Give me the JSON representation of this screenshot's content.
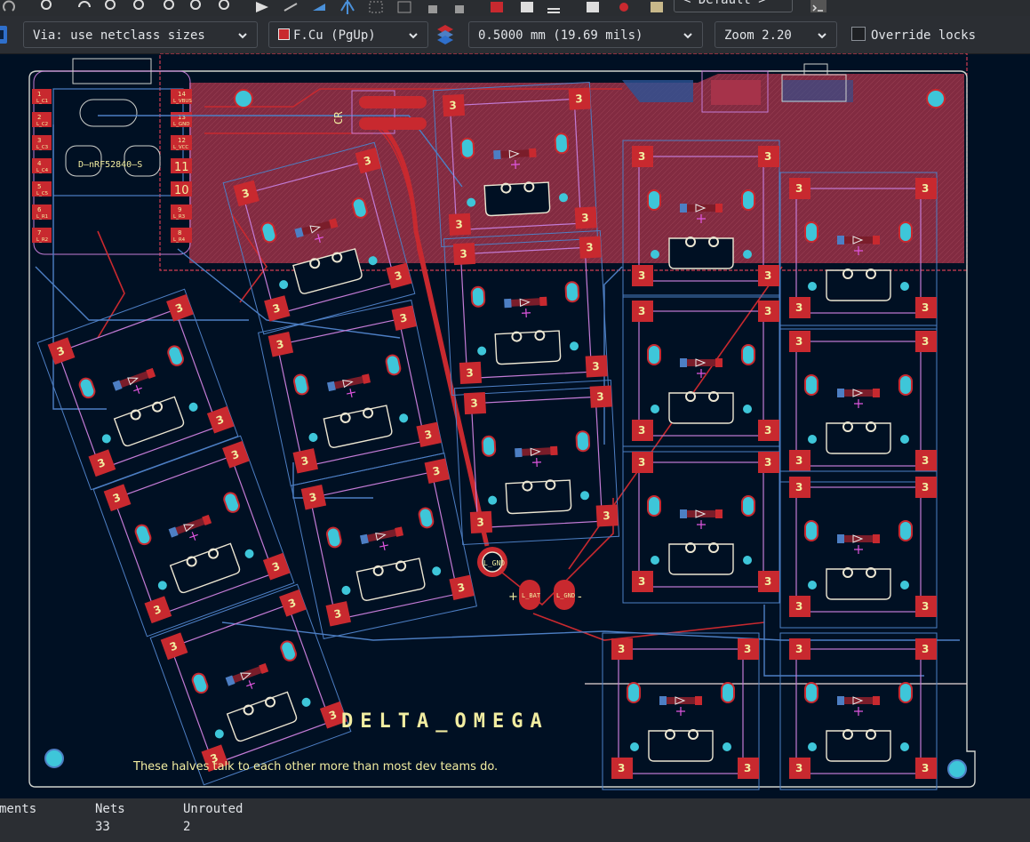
{
  "toolbar": {
    "via_size": "Via: use netclass sizes",
    "layer": "F.Cu (PgUp)",
    "track_width": "0.5000 mm (19.69 mils)",
    "zoom": "Zoom 2.20",
    "override_locks": "Override locks",
    "override_locks_checked": false,
    "view_preset": "< Default >"
  },
  "board": {
    "title": "DELTA_OMEGA",
    "tagline": "These halves talk to each other more than most dev teams do.",
    "mcu_label": "D—nRF52840—S",
    "switch_pad_label": "3",
    "header_pins": [
      "1",
      "2",
      "3",
      "4",
      "5",
      "6",
      "7"
    ],
    "header_pin_labels": [
      "L_C1",
      "L_C2",
      "L_C3",
      "L_C4",
      "L_C5",
      "L_R1",
      "L_R2"
    ],
    "right_pins": [
      "14",
      "13",
      "12",
      "11",
      "10",
      "9",
      "8"
    ],
    "right_pin_labels": [
      "L_VBUS",
      "L_GND",
      "L_VCC",
      "",
      "",
      "L_R3",
      "L_R4"
    ],
    "gnd_label": "L_GND",
    "batt_plus": "+",
    "batt_minus": "-",
    "batt_labels": [
      "L_BAT",
      "L_GND"
    ],
    "silk_cr": "CR"
  },
  "status": {
    "col1_header": "ments",
    "nets_header": "Nets",
    "nets_value": "33",
    "unrouted_header": "Unrouted",
    "unrouted_value": "2"
  },
  "colors": {
    "background": "#001023",
    "copper_front": "#c8292f",
    "copper_back": "#4d7fc4",
    "board_edge": "#d0d2cd",
    "courtyard": "#c2c2c2",
    "silkscreen": "#f2eda1",
    "via": "#ece6d2",
    "hole": "#3ec6d9"
  }
}
